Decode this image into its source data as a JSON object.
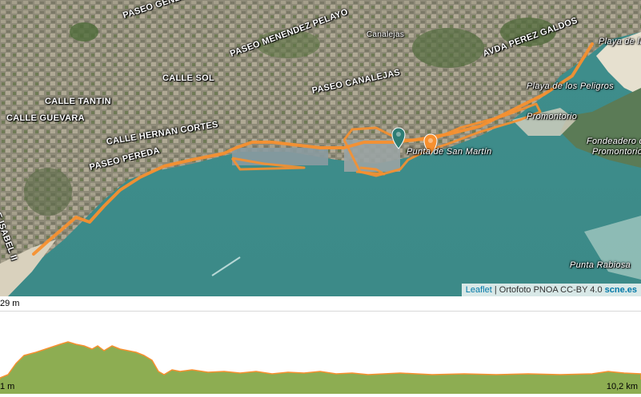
{
  "map": {
    "labels": {
      "paseo_general": "PASEO GENERAL",
      "paseo_menendez_pelayo": "PASEO MENENDEZ PELAYO",
      "avda_perez_galdos": "AVDA PEREZ GALDOS",
      "canalejas": "Canalejas",
      "calle_sol": "CALLE SOL",
      "paseo_canalejas": "PASEO CANALEJAS",
      "calle_tantin": "CALLE TANTIN",
      "calle_guevara": "CALLE GUEVARA",
      "calle_hernan_cortes": "CALLE HERNAN CORTES",
      "paseo_pereda": "PASEO PEREDA",
      "calle_isabel_ii": "CALLE ISABEL II",
      "playa_magdalena": "Playa de la Mag",
      "playa_peligros": "Playa de los Peligros",
      "promontorio": "Promontorio",
      "fondeadero": "Fondeadero de",
      "promontorio2": "Promontorio",
      "punta_san_martin": "Punta de San Martín",
      "punta_rabiosa": "Punta Rabiosa"
    },
    "route_color": "#f7902f",
    "marker_start_color": "#2e7d74",
    "marker_end_color": "#f7902f",
    "attribution": {
      "leaflet": "Leaflet",
      "sep1": " | ",
      "ortofoto": "Ortofoto PNOA CC-BY 4.0",
      "sep2": " ",
      "scne": "scne.es"
    }
  },
  "profile": {
    "max_elevation": "29 m",
    "min_elevation": "1 m",
    "distance": "10,2 km",
    "fill_color": "#8dad52",
    "line_color": "#f7902f"
  }
}
